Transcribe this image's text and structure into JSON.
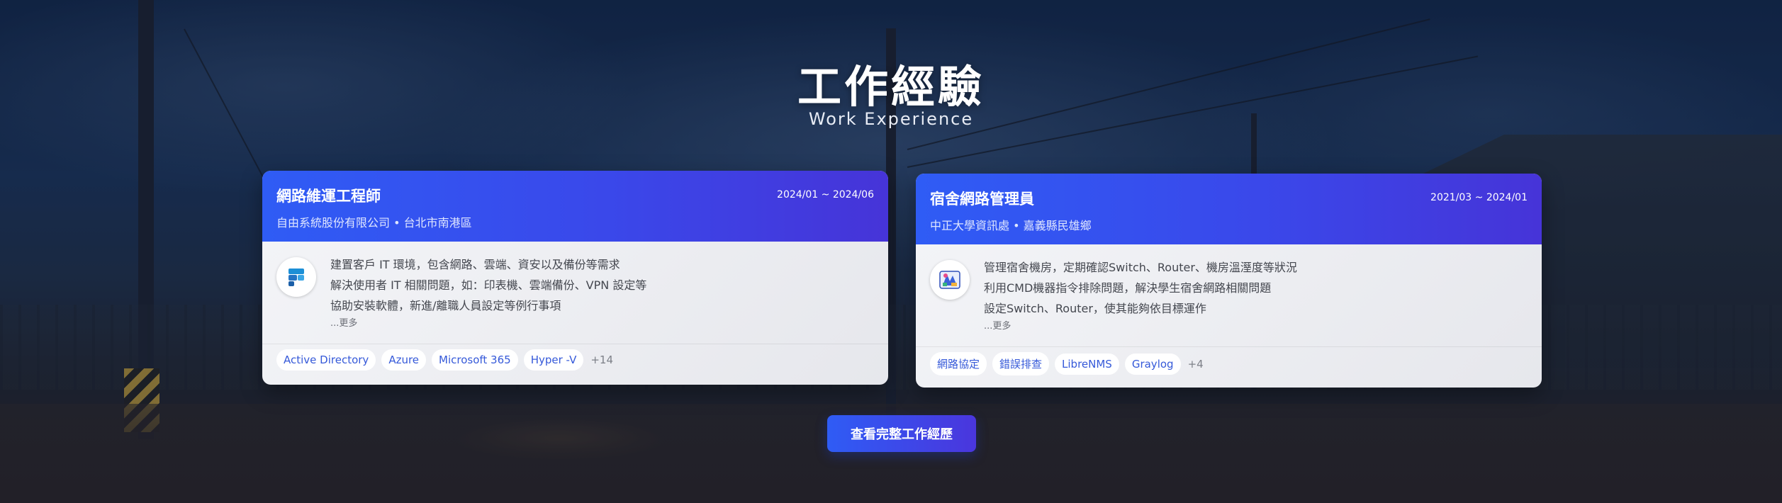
{
  "section": {
    "title": "工作經驗",
    "subtitle": "Work Experience"
  },
  "experiences": [
    {
      "role": "網路維運工程師",
      "company": "自由系統股份有限公司 • 台北市南港區",
      "date": "2024/01 ~ 2024/06",
      "duties": [
        "建置客戶 IT 環境，包含網路、雲端、資安以及備份等需求",
        "解決使用者 IT 相關問題，如：印表機、雲端備份、VPN 設定等",
        "協助安裝軟體，新進/離職人員設定等例行事項"
      ],
      "more": "...更多",
      "tags": [
        "Active Directory",
        "Azure",
        "Microsoft 365",
        "Hyper -V"
      ],
      "tags_more": "+14",
      "logo_icon": "company-logo-icon"
    },
    {
      "role": "宿舍網路管理員",
      "company": "中正大學資訊處 • 嘉義縣民雄鄉",
      "date": "2021/03 ~ 2024/01",
      "duties": [
        "管理宿舍機房，定期確認Switch、Router、機房溫溼度等狀況",
        "利用CMD機器指令排除問題，解決學生宿舍網路相關問題",
        "設定Switch、Router，使其能夠依目標運作"
      ],
      "more": "...更多",
      "tags": [
        "網路協定",
        "錯誤排查",
        "LibreNMS",
        "Graylog"
      ],
      "tags_more": "+4",
      "logo_icon": "university-logo-icon"
    }
  ],
  "cta": {
    "label": "查看完整工作經歷"
  }
}
